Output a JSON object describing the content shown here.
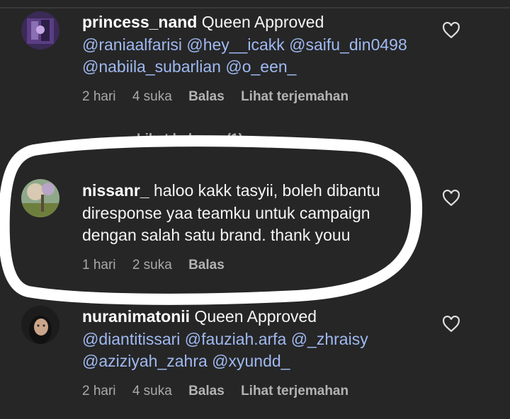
{
  "comments": [
    {
      "username": "princess_nand",
      "text_lines": [
        "Queen Approved"
      ],
      "mentions_lines": [
        "@raniaalfarisi @hey__icakk @saifu_din0498",
        "@nabiila_subarlian @o_een_"
      ],
      "time": "2 hari",
      "likes": "4 suka",
      "reply": "Balas",
      "translate": "Lihat terjemahan",
      "view_replies": "Lihat balasan (1)"
    },
    {
      "username": "nissanr_",
      "text_lines": [
        "haloo kakk tasyii, boleh dibantu",
        "diresponse yaa teamku untuk campaign",
        "dengan salah satu brand. thank youu"
      ],
      "time": "1 hari",
      "likes": "2 suka",
      "reply": "Balas"
    },
    {
      "username": "nuranimatonii",
      "text_lines": [
        "Queen Approved"
      ],
      "mentions_lines": [
        "@diantitissari @fauziah.arfa @_zhraisy",
        "@aziziyah_zahra @xyundd_"
      ],
      "time": "2 hari",
      "likes": "4 suka",
      "reply": "Balas",
      "translate": "Lihat terjemahan"
    }
  ],
  "icons": {
    "like": "heart-outline-icon"
  },
  "colors": {
    "background": "#262626",
    "mention": "#9fb9f2",
    "meta": "#a9a9a9",
    "annotation": "#ffffff"
  }
}
